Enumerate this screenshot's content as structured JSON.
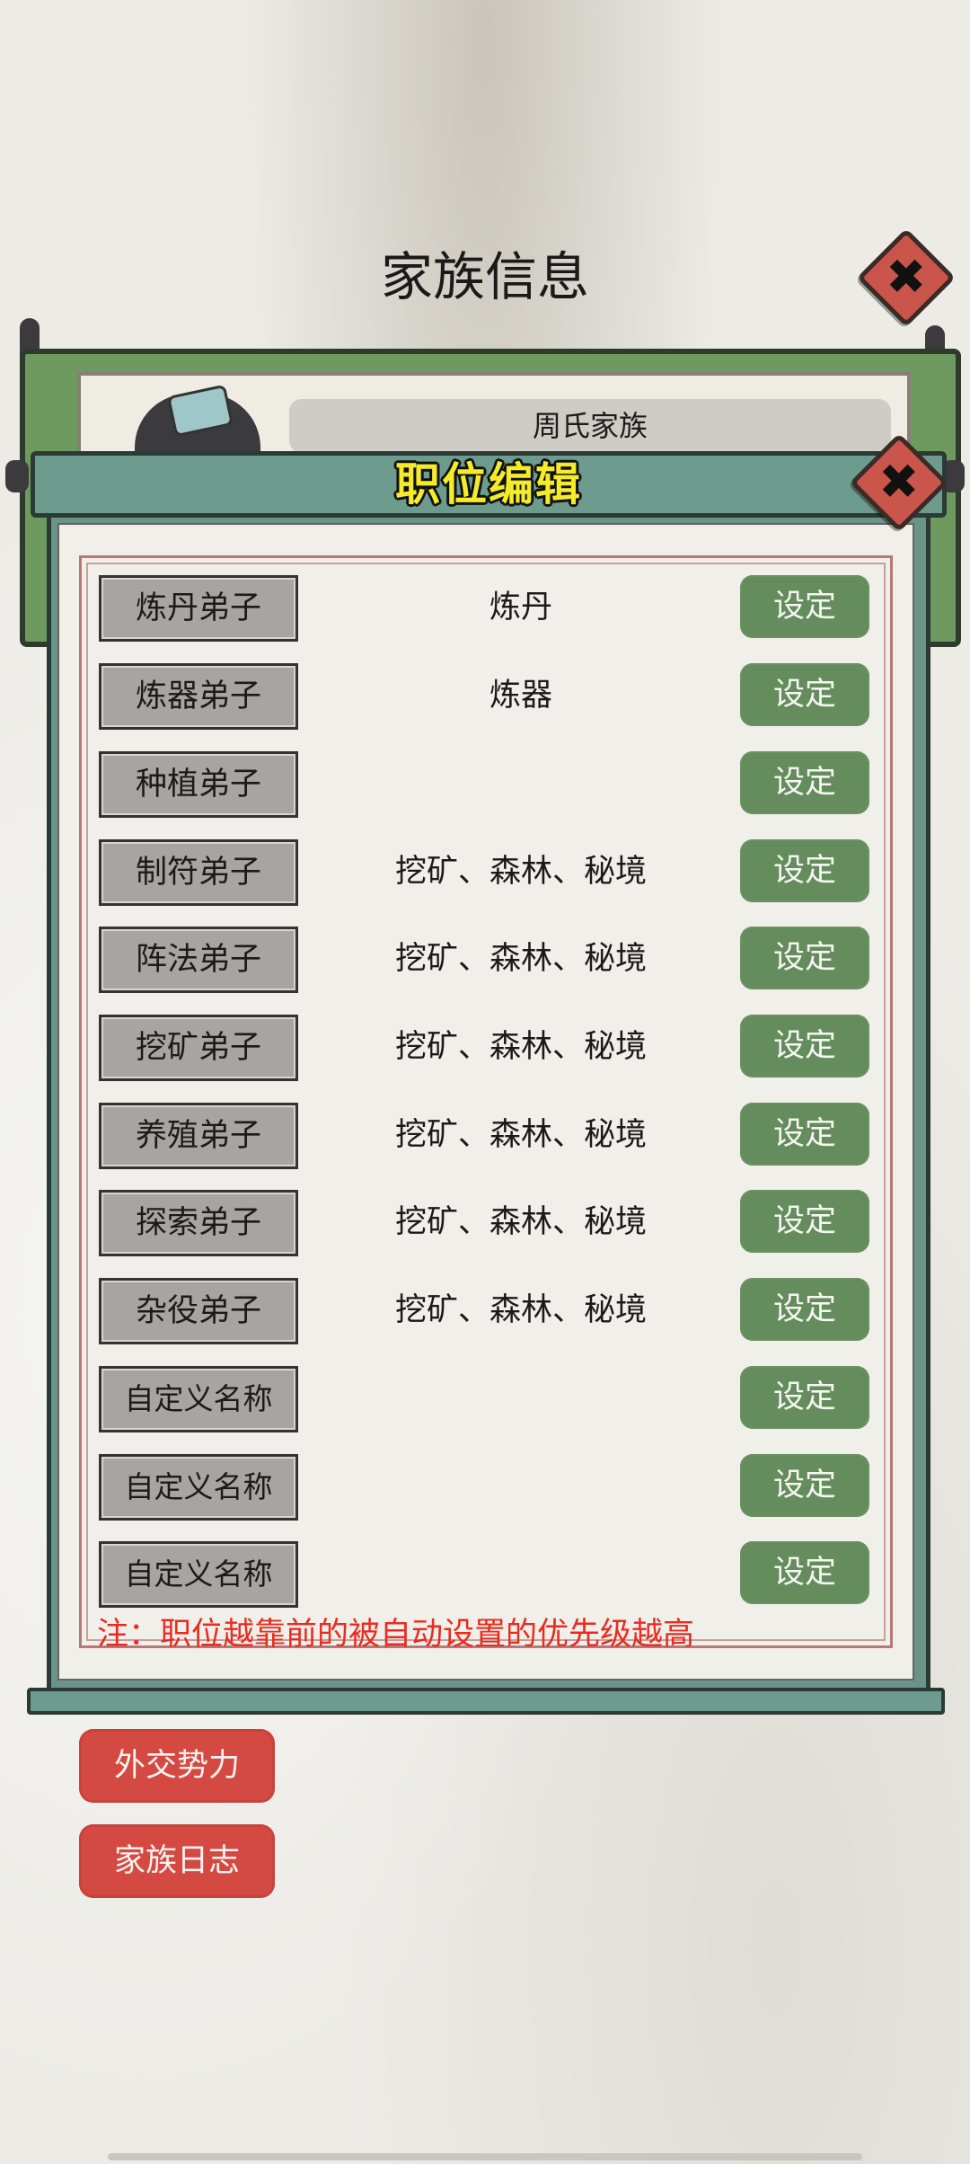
{
  "header": {
    "title": "家族信息",
    "close_symbol": "✖"
  },
  "family": {
    "name": "周氏家族"
  },
  "dialog": {
    "title": "职位编辑",
    "close_symbol": "✖",
    "rows": [
      {
        "role": "炼丹弟子",
        "value": "炼丹",
        "button": "设定"
      },
      {
        "role": "炼器弟子",
        "value": "炼器",
        "button": "设定"
      },
      {
        "role": "种植弟子",
        "value": "",
        "button": "设定"
      },
      {
        "role": "制符弟子",
        "value": "挖矿、森林、秘境",
        "button": "设定"
      },
      {
        "role": "阵法弟子",
        "value": "挖矿、森林、秘境",
        "button": "设定"
      },
      {
        "role": "挖矿弟子",
        "value": "挖矿、森林、秘境",
        "button": "设定"
      },
      {
        "role": "养殖弟子",
        "value": "挖矿、森林、秘境",
        "button": "设定"
      },
      {
        "role": "探索弟子",
        "value": "挖矿、森林、秘境",
        "button": "设定"
      },
      {
        "role": "杂役弟子",
        "value": "挖矿、森林、秘境",
        "button": "设定"
      },
      {
        "role": "自定义名称",
        "value": "",
        "button": "设定"
      },
      {
        "role": "自定义名称",
        "value": "",
        "button": "设定"
      },
      {
        "role": "自定义名称",
        "value": "",
        "button": "设定"
      }
    ],
    "note": "注：职位越靠前的被自动设置的优先级越高"
  },
  "buttons": {
    "diplomacy": "外交势力",
    "family_log": "家族日志"
  },
  "colors": {
    "accent_green": "#648c5c",
    "accent_red": "#d44a43",
    "title_yellow": "#f4eb2a",
    "note_red": "#ea2b1f"
  }
}
